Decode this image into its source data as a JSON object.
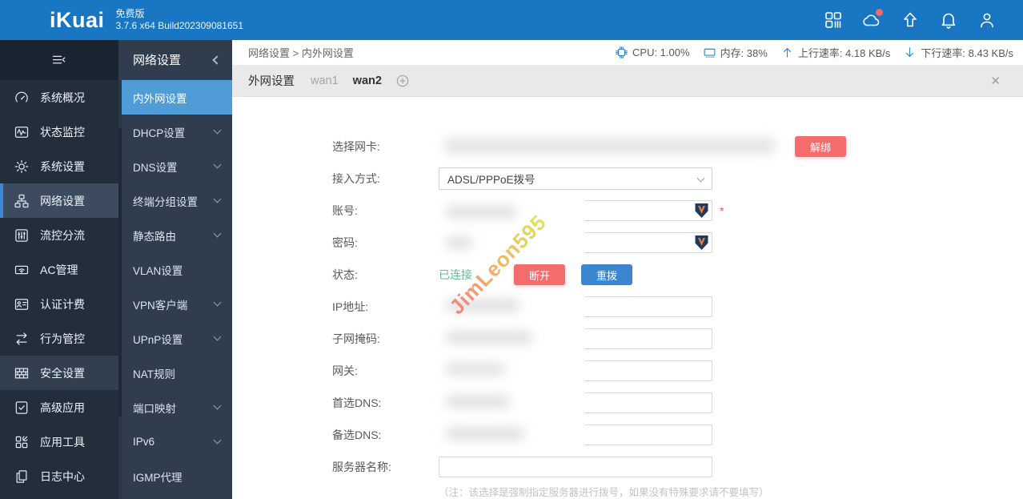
{
  "header": {
    "logo": "iKuai",
    "edition": "免费版",
    "build": "3.7.6 x64 Build202309081651"
  },
  "sidebar": {
    "items": [
      {
        "label": "系统概况"
      },
      {
        "label": "状态监控"
      },
      {
        "label": "系统设置"
      },
      {
        "label": "网络设置"
      },
      {
        "label": "流控分流"
      },
      {
        "label": "AC管理"
      },
      {
        "label": "认证计费"
      },
      {
        "label": "行为管控"
      },
      {
        "label": "安全设置"
      },
      {
        "label": "高级应用"
      },
      {
        "label": "应用工具"
      },
      {
        "label": "日志中心"
      }
    ]
  },
  "submenu": {
    "title": "网络设置",
    "items": [
      {
        "label": "内外网设置"
      },
      {
        "label": "DHCP设置"
      },
      {
        "label": "DNS设置"
      },
      {
        "label": "终端分组设置"
      },
      {
        "label": "静态路由"
      },
      {
        "label": "VLAN设置"
      },
      {
        "label": "VPN客户端"
      },
      {
        "label": "UPnP设置"
      },
      {
        "label": "NAT规则"
      },
      {
        "label": "端口映射"
      },
      {
        "label": "IPv6"
      },
      {
        "label": "IGMP代理"
      }
    ]
  },
  "topbar": {
    "breadcrumb": "网络设置 > 内外网设置",
    "cpu": "CPU: 1.00%",
    "memory": "内存: 38%",
    "upload": "上行速率: 4.18 KB/s",
    "download": "下行速率: 8.43 KB/s"
  },
  "tabbar": {
    "group_label": "外网设置",
    "tabs": [
      {
        "label": "wan1"
      },
      {
        "label": "wan2"
      }
    ],
    "close_glyph": "✕"
  },
  "form": {
    "nic_label": "选择网卡:",
    "unbind_button": "解绑",
    "access_label": "接入方式:",
    "access_value": "ADSL/PPPoE拨号",
    "account_label": "账号:",
    "required_mark": "*",
    "password_label": "密码:",
    "status_label": "状态:",
    "status_value": "已连接",
    "disconnect_button": "断开",
    "redial_button": "重拨",
    "ip_label": "IP地址:",
    "mask_label": "子网掩码:",
    "gateway_label": "网关:",
    "dns1_label": "首选DNS:",
    "dns2_label": "备选DNS:",
    "server_label": "服务器名称:",
    "server_note": "（注：该选择是强制指定服务器进行拨号，如果没有特殊要求请不要填写）"
  },
  "watermark": "JimLeon595",
  "colors": {
    "topbar_blue": "#1976c2",
    "active_menu_blue": "#4f9cd6",
    "accent_red": "#f56c6c",
    "accent_blue": "#3c86cf",
    "connected_green": "#5fbe8d"
  }
}
